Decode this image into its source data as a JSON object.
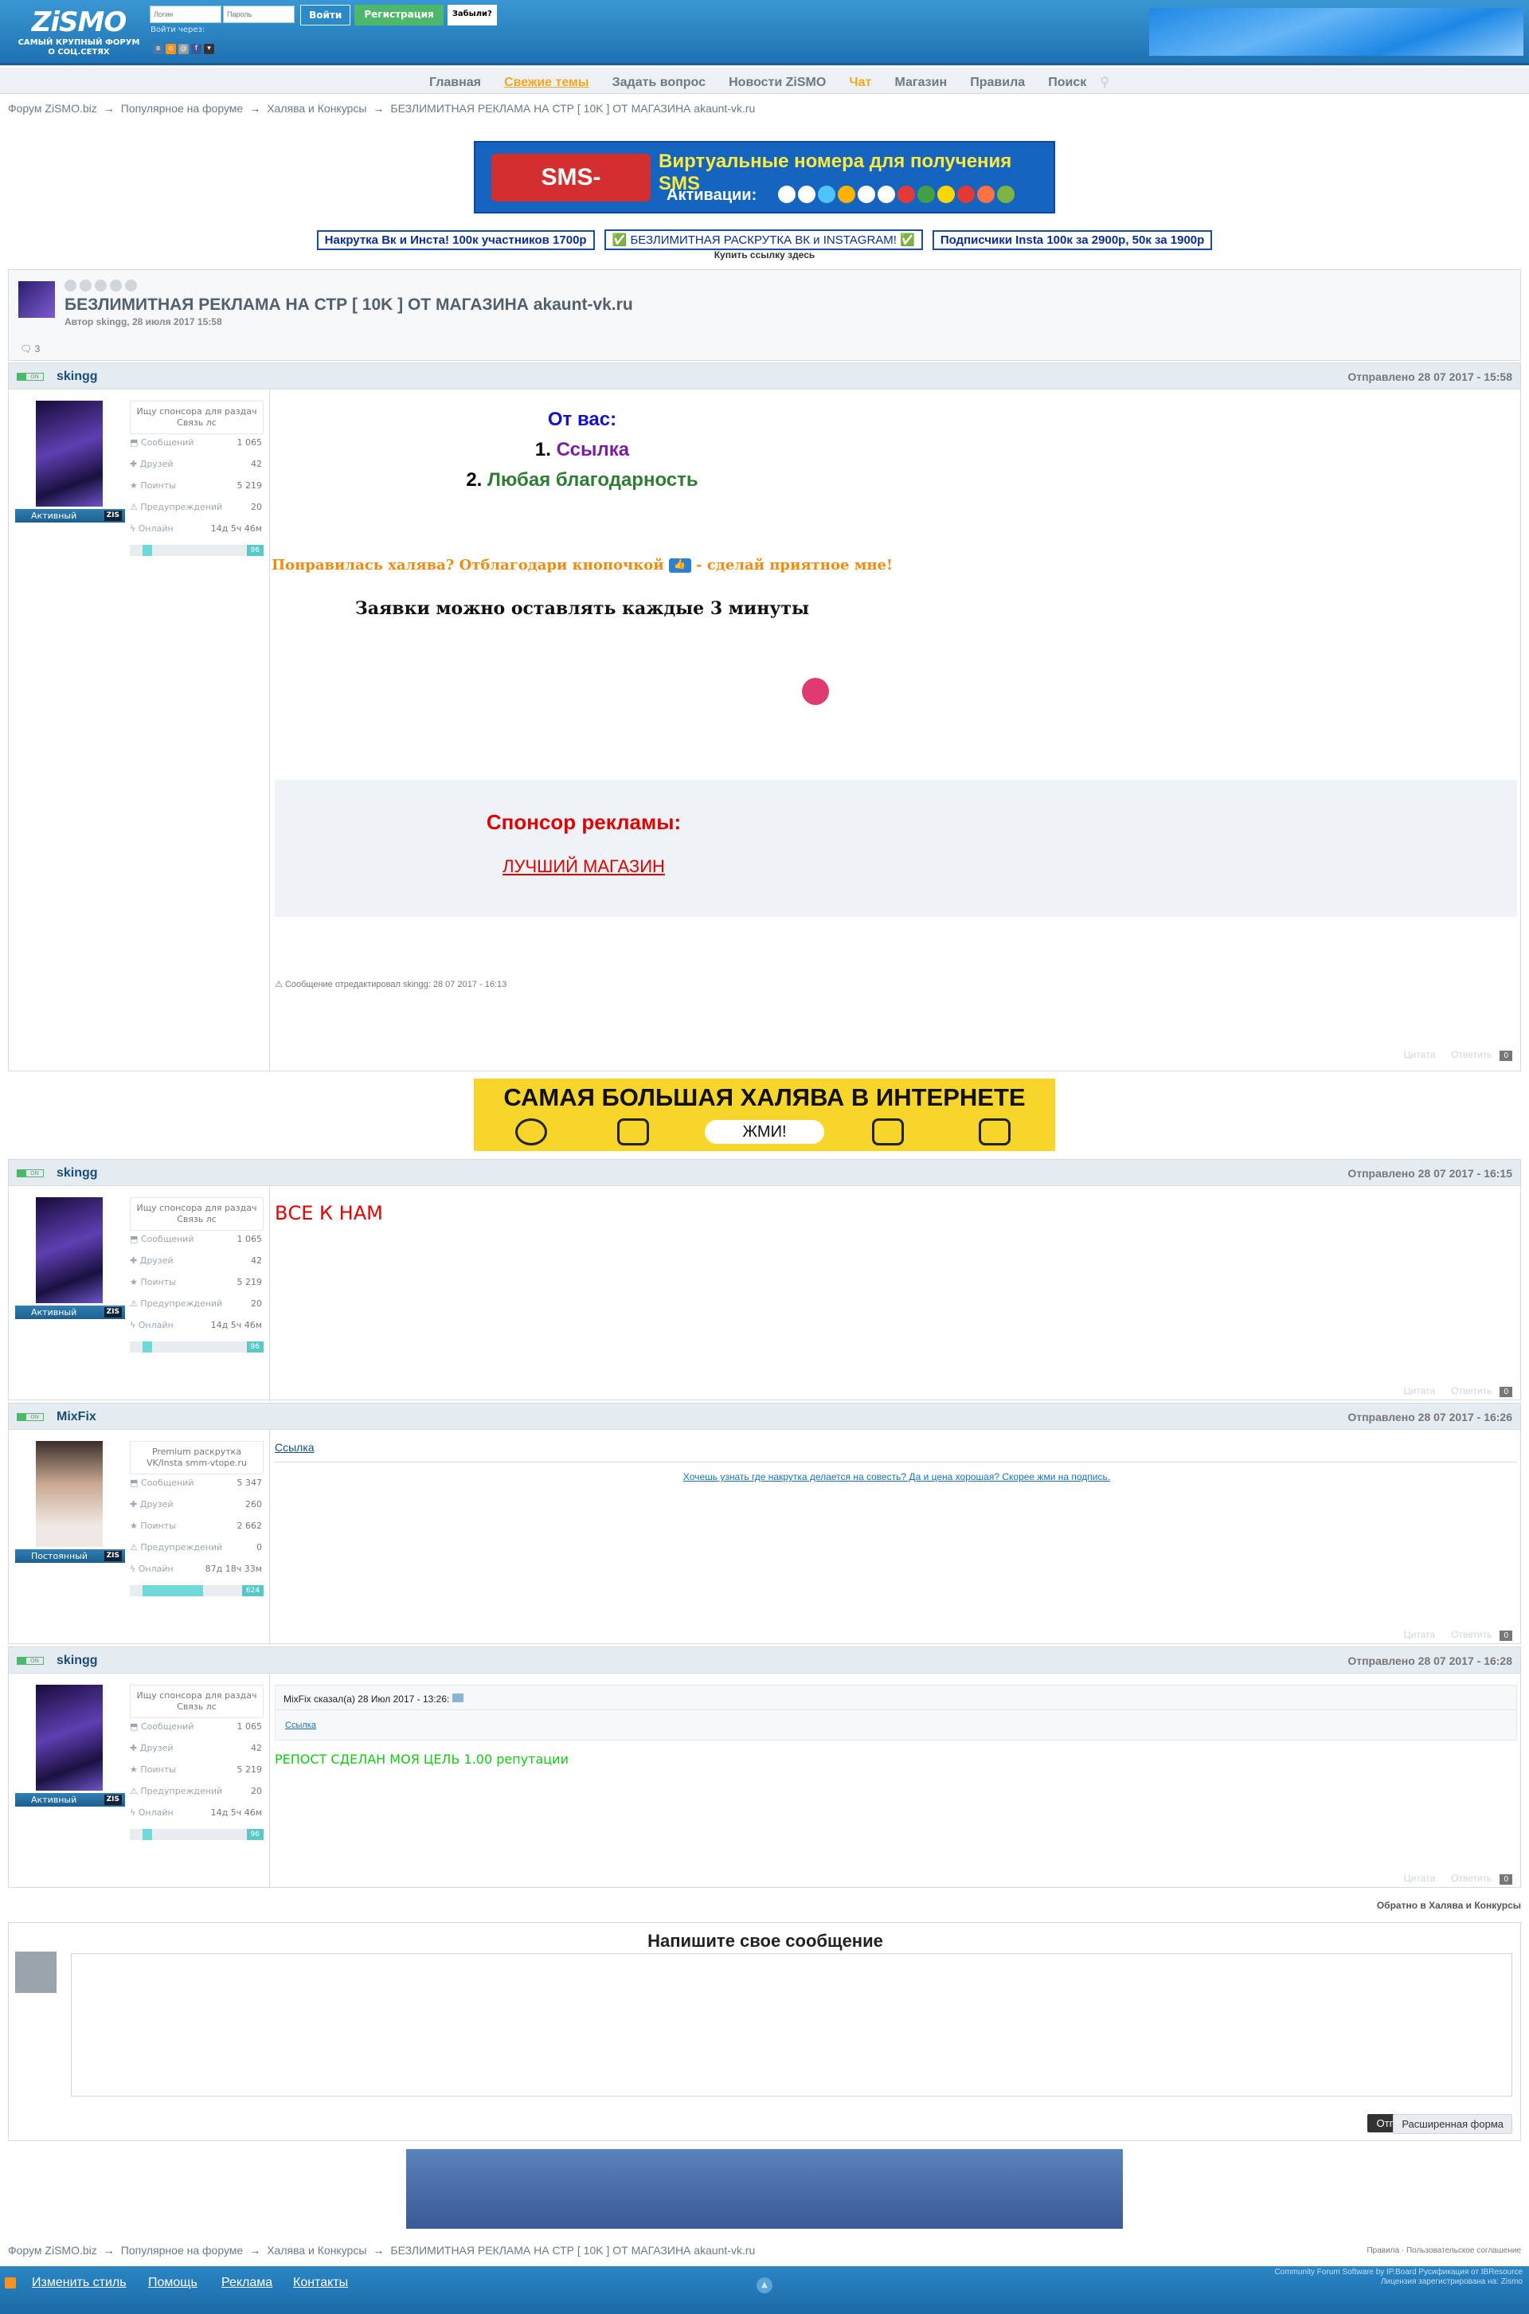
{
  "header": {
    "logo": "ZiSMO",
    "tagline1": "САМЫЙ КРУПНЫЙ ФОРУМ",
    "tagline2": "О СОЦ.СЕТЯХ",
    "login_placeholder": "Логин",
    "password_placeholder": "Пароль",
    "login_button": "Войти",
    "register_button": "Регистрация",
    "forgot_button": "Забыли?",
    "login_via": "Войти через:"
  },
  "nav": [
    "Главная",
    "Свежие темы",
    "Задать вопрос",
    "Новости ZiSMO",
    "Чат",
    "Магазин",
    "Правила",
    "Поиск"
  ],
  "breadcrumb": [
    "Форум ZiSMO.biz",
    "Популярное на форуме",
    "Халява и Конкурсы",
    "БЕЗЛИМИТНАЯ РЕКЛАМА НА СТР [ 10K ] ОТ МАГАЗИНА akaunt-vk.ru"
  ],
  "top_banner": {
    "logo": "SMS-REG.com",
    "line1": "Виртуальные номера для получения SMS",
    "line2": "Активации:"
  },
  "links": [
    "Накрутка Вк и Инста! 100к участников 1700р",
    "✅ БЕЗЛИМИТНАЯ РАСКРУТКА ВК и INSTAGRAM! ✅",
    "Подписчики Insta 100к за 2900р, 50к за 1900р"
  ],
  "buy_link": "Купить ссылку здесь",
  "topic": {
    "title": "БЕЗЛИМИТНАЯ РЕКЛАМА НА СТР [ 10K ] ОТ МАГАЗИНА akaunt-vk.ru",
    "meta": "Автор skingg, 28 июля 2017 15:58",
    "replies": "3"
  },
  "labels": {
    "messages": "Сообщений",
    "friends": "Друзей",
    "points": "Поинты",
    "warnings": "Предупреждений",
    "online": "Онлайн",
    "quote": "Цитата",
    "reply": "Ответить",
    "online_tag": "ON"
  },
  "users": {
    "skingg": {
      "name": "skingg",
      "status": "Ищу спонсора для раздач Связь лс",
      "rank": "Активный",
      "messages": "1 065",
      "friends": "42",
      "points": "5 219",
      "warnings": "20",
      "online": "14д 5ч 46м",
      "rep": "96",
      "rep_level": 0.07
    },
    "mixfix": {
      "name": "MixFix",
      "status": "Premium раскрутка VK/Insta smm-vtope.ru",
      "rank": "Постоянный",
      "messages": "5 347",
      "friends": "260",
      "points": "2 662",
      "warnings": "0",
      "online": "87д 18ч 33м",
      "rep": "624",
      "rep_level": 0.45
    }
  },
  "posts": [
    {
      "date": "Отправлено 28 07 2017 - 15:58",
      "from_you": "От вас:",
      "item1_num": "1.",
      "item1": "Ссылка",
      "item2_num": "2.",
      "item2": "Любая благодарность",
      "like_line1": "Понравилась халява? Отблагодари кнопочкой",
      "like_line2": "- сделай приятное мне!",
      "requests": "Заявки можно оставлять каждые 3 минуты",
      "sponsor_title": "Спонсор рекламы:",
      "sponsor_link": "ЛУЧШИЙ МАГАЗИН",
      "edited": "Сообщение отредактировал skingg: 28 07 2017 - 16:13",
      "count": "0"
    },
    {
      "date": "Отправлено 28 07 2017 - 16:15",
      "text": "ВСЕ К НАМ",
      "count": "0"
    },
    {
      "date": "Отправлено 28 07 2017 - 16:26",
      "link": "Ссылка",
      "sig": "Хочешь узнать где накрутка делается на совесть? Да и цена хорошая? Скорее жми на подпись.",
      "count": "0"
    },
    {
      "date": "Отправлено 28 07 2017 - 16:28",
      "quote_head": "MixFix сказал(а) 28 Июл 2017 - 13:26:",
      "quote_link": "Ссылка",
      "text": "РЕПОСТ СДЕЛАН МОЯ ЦЕЛЬ 1.00 репутации",
      "count": "0"
    }
  ],
  "ad_big": {
    "title": "САМАЯ БОЛЬШАЯ ХАЛЯВА В ИНТЕРНЕТЕ",
    "button": "ЖМИ!"
  },
  "back_link": "Обратно в Халява и Конкурсы",
  "reply_form": {
    "title": "Напишите свое сообщение",
    "send": "Отправить",
    "advanced": "Расширенная форма"
  },
  "footer": {
    "right_links": "Правила · Пользовательское соглашение",
    "links": [
      "Изменить стиль",
      "Помощь",
      "Реклама",
      "Контакты"
    ],
    "copy1": "Community Forum Software by IP.Board Русификация от IBResource",
    "copy2": "Лицензия зарегистрирована на: Zismo"
  },
  "colors": {
    "header": "#2a86c6",
    "accent": "#f5a623",
    "nav_text": "#6a7a86"
  }
}
